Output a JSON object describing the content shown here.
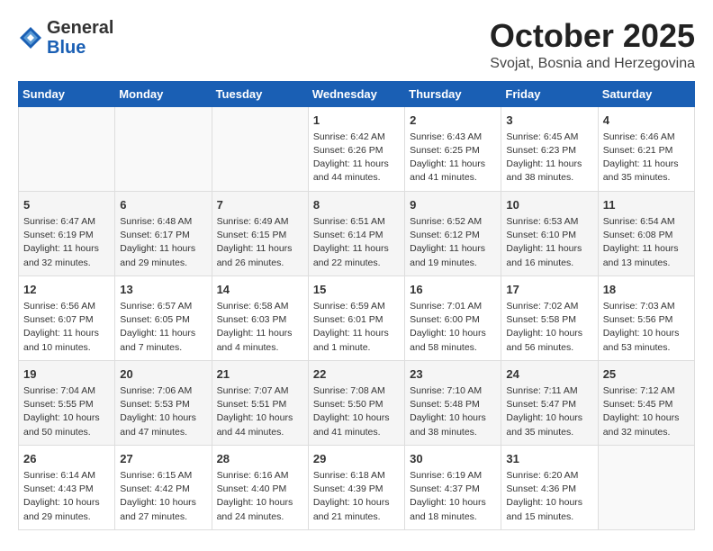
{
  "header": {
    "logo_general": "General",
    "logo_blue": "Blue",
    "month": "October 2025",
    "location": "Svojat, Bosnia and Herzegovina"
  },
  "weekdays": [
    "Sunday",
    "Monday",
    "Tuesday",
    "Wednesday",
    "Thursday",
    "Friday",
    "Saturday"
  ],
  "weeks": [
    [
      {
        "day": "",
        "info": ""
      },
      {
        "day": "",
        "info": ""
      },
      {
        "day": "",
        "info": ""
      },
      {
        "day": "1",
        "info": "Sunrise: 6:42 AM\nSunset: 6:26 PM\nDaylight: 11 hours and 44 minutes."
      },
      {
        "day": "2",
        "info": "Sunrise: 6:43 AM\nSunset: 6:25 PM\nDaylight: 11 hours and 41 minutes."
      },
      {
        "day": "3",
        "info": "Sunrise: 6:45 AM\nSunset: 6:23 PM\nDaylight: 11 hours and 38 minutes."
      },
      {
        "day": "4",
        "info": "Sunrise: 6:46 AM\nSunset: 6:21 PM\nDaylight: 11 hours and 35 minutes."
      }
    ],
    [
      {
        "day": "5",
        "info": "Sunrise: 6:47 AM\nSunset: 6:19 PM\nDaylight: 11 hours and 32 minutes."
      },
      {
        "day": "6",
        "info": "Sunrise: 6:48 AM\nSunset: 6:17 PM\nDaylight: 11 hours and 29 minutes."
      },
      {
        "day": "7",
        "info": "Sunrise: 6:49 AM\nSunset: 6:15 PM\nDaylight: 11 hours and 26 minutes."
      },
      {
        "day": "8",
        "info": "Sunrise: 6:51 AM\nSunset: 6:14 PM\nDaylight: 11 hours and 22 minutes."
      },
      {
        "day": "9",
        "info": "Sunrise: 6:52 AM\nSunset: 6:12 PM\nDaylight: 11 hours and 19 minutes."
      },
      {
        "day": "10",
        "info": "Sunrise: 6:53 AM\nSunset: 6:10 PM\nDaylight: 11 hours and 16 minutes."
      },
      {
        "day": "11",
        "info": "Sunrise: 6:54 AM\nSunset: 6:08 PM\nDaylight: 11 hours and 13 minutes."
      }
    ],
    [
      {
        "day": "12",
        "info": "Sunrise: 6:56 AM\nSunset: 6:07 PM\nDaylight: 11 hours and 10 minutes."
      },
      {
        "day": "13",
        "info": "Sunrise: 6:57 AM\nSunset: 6:05 PM\nDaylight: 11 hours and 7 minutes."
      },
      {
        "day": "14",
        "info": "Sunrise: 6:58 AM\nSunset: 6:03 PM\nDaylight: 11 hours and 4 minutes."
      },
      {
        "day": "15",
        "info": "Sunrise: 6:59 AM\nSunset: 6:01 PM\nDaylight: 11 hours and 1 minute."
      },
      {
        "day": "16",
        "info": "Sunrise: 7:01 AM\nSunset: 6:00 PM\nDaylight: 10 hours and 58 minutes."
      },
      {
        "day": "17",
        "info": "Sunrise: 7:02 AM\nSunset: 5:58 PM\nDaylight: 10 hours and 56 minutes."
      },
      {
        "day": "18",
        "info": "Sunrise: 7:03 AM\nSunset: 5:56 PM\nDaylight: 10 hours and 53 minutes."
      }
    ],
    [
      {
        "day": "19",
        "info": "Sunrise: 7:04 AM\nSunset: 5:55 PM\nDaylight: 10 hours and 50 minutes."
      },
      {
        "day": "20",
        "info": "Sunrise: 7:06 AM\nSunset: 5:53 PM\nDaylight: 10 hours and 47 minutes."
      },
      {
        "day": "21",
        "info": "Sunrise: 7:07 AM\nSunset: 5:51 PM\nDaylight: 10 hours and 44 minutes."
      },
      {
        "day": "22",
        "info": "Sunrise: 7:08 AM\nSunset: 5:50 PM\nDaylight: 10 hours and 41 minutes."
      },
      {
        "day": "23",
        "info": "Sunrise: 7:10 AM\nSunset: 5:48 PM\nDaylight: 10 hours and 38 minutes."
      },
      {
        "day": "24",
        "info": "Sunrise: 7:11 AM\nSunset: 5:47 PM\nDaylight: 10 hours and 35 minutes."
      },
      {
        "day": "25",
        "info": "Sunrise: 7:12 AM\nSunset: 5:45 PM\nDaylight: 10 hours and 32 minutes."
      }
    ],
    [
      {
        "day": "26",
        "info": "Sunrise: 6:14 AM\nSunset: 4:43 PM\nDaylight: 10 hours and 29 minutes."
      },
      {
        "day": "27",
        "info": "Sunrise: 6:15 AM\nSunset: 4:42 PM\nDaylight: 10 hours and 27 minutes."
      },
      {
        "day": "28",
        "info": "Sunrise: 6:16 AM\nSunset: 4:40 PM\nDaylight: 10 hours and 24 minutes."
      },
      {
        "day": "29",
        "info": "Sunrise: 6:18 AM\nSunset: 4:39 PM\nDaylight: 10 hours and 21 minutes."
      },
      {
        "day": "30",
        "info": "Sunrise: 6:19 AM\nSunset: 4:37 PM\nDaylight: 10 hours and 18 minutes."
      },
      {
        "day": "31",
        "info": "Sunrise: 6:20 AM\nSunset: 4:36 PM\nDaylight: 10 hours and 15 minutes."
      },
      {
        "day": "",
        "info": ""
      }
    ]
  ]
}
